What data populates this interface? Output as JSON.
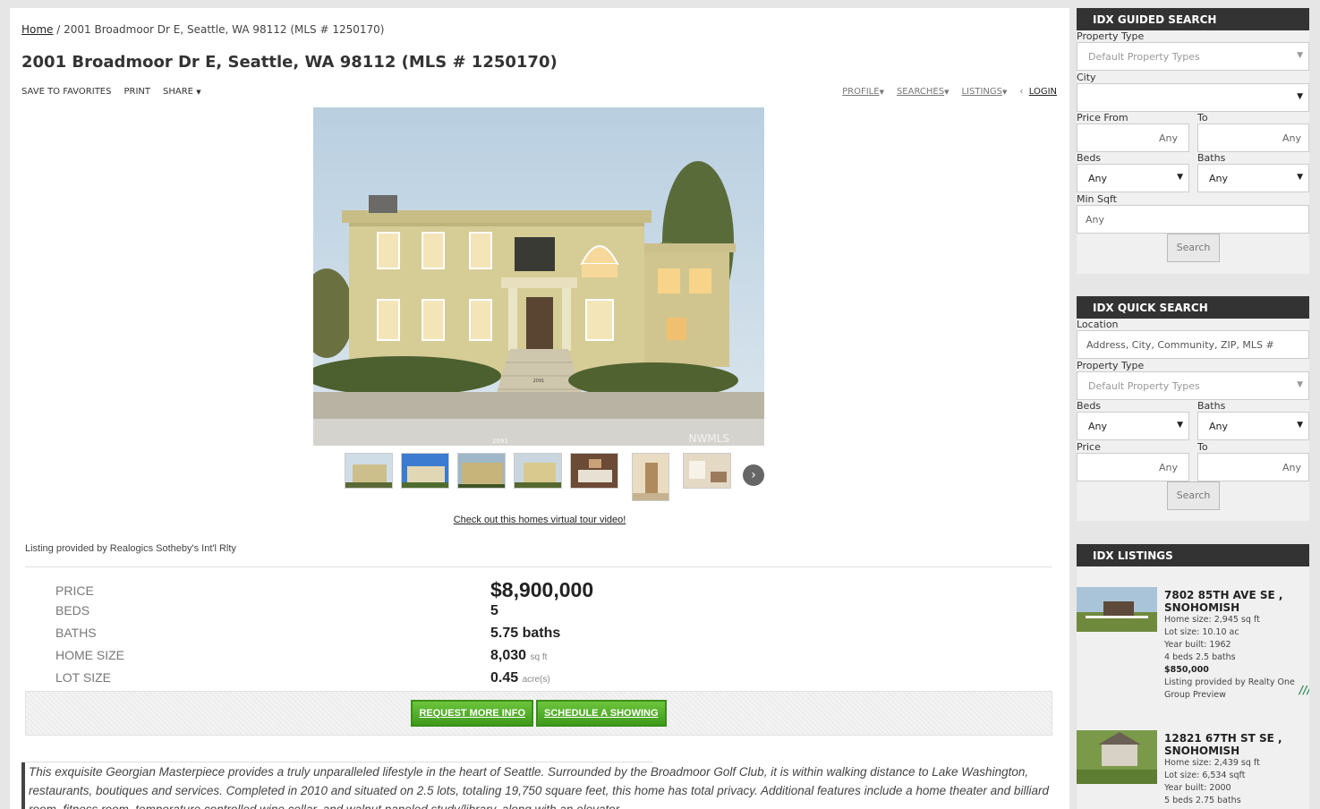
{
  "breadcrumb": {
    "home": "Home",
    "separator": " / ",
    "current": "2001 Broadmoor Dr E, Seattle, WA 98112 (MLS # 1250170)"
  },
  "page_title": "2001 Broadmoor Dr E, Seattle, WA 98112 (MLS # 1250170)",
  "actions": {
    "save": "SAVE TO FAVORITES",
    "print": "PRINT",
    "share": "SHARE"
  },
  "nav": {
    "profile": "PROFILE",
    "searches": "SEARCHES",
    "listings": "LISTINGS",
    "login": "LOGIN"
  },
  "hero": {
    "house_number": "2091",
    "street_number": "2091",
    "watermark": "NWMLS"
  },
  "virtual_tour": "Check out this homes virtual tour video!",
  "listing_provided": "Listing provided by Realogics Sotheby's Int'l Rlty",
  "facts": [
    {
      "label": "PRICE",
      "value": "$8,900,000",
      "unit": ""
    },
    {
      "label": "BEDS",
      "value": "5",
      "unit": ""
    },
    {
      "label": "BATHS",
      "value": "5.75 baths",
      "unit": ""
    },
    {
      "label": "HOME SIZE",
      "value": "8,030",
      "unit": "sq ft"
    },
    {
      "label": "LOT SIZE",
      "value": "0.45",
      "unit": "acre(s)"
    }
  ],
  "cta": {
    "request": "REQUEST MORE INFO",
    "schedule": "SCHEDULE A SHOWING"
  },
  "description": "This exquisite Georgian Masterpiece provides a truly unparalleled lifestyle in the heart of Seattle. Surrounded by the Broadmoor Golf Club, it is within walking distance to Lake Washington, restaurants, boutiques and services. Completed in 2010 and situated on 2.5 lots, totaling 19,750 square feet, this home has total privacy. Additional features include a home theater and billiard room, fitness room, temperature controlled wine cellar, and walnut paneled study/library, along with an elevator.",
  "guided_search": {
    "title": "IDX GUIDED SEARCH",
    "property_type_label": "Property Type",
    "property_type_value": "Default Property Types",
    "city_label": "City",
    "city_value": "",
    "price_from_label": "Price From",
    "price_from_value": "Any",
    "to_label": "To",
    "to_value": "Any",
    "beds_label": "Beds",
    "beds_value": "Any",
    "baths_label": "Baths",
    "baths_value": "Any",
    "min_sqft_label": "Min Sqft",
    "min_sqft_value": "Any",
    "search": "Search"
  },
  "quick_search": {
    "title": "IDX QUICK SEARCH",
    "location_label": "Location",
    "location_placeholder": "Address, City, Community, ZIP, MLS #",
    "property_type_label": "Property Type",
    "property_type_value": "Default Property Types",
    "beds_label": "Beds",
    "beds_value": "Any",
    "baths_label": "Baths",
    "baths_value": "Any",
    "price_label": "Price",
    "price_value": "Any",
    "to_label": "To",
    "to_value": "Any",
    "search": "Search"
  },
  "idx_listings": {
    "title": "IDX LISTINGS",
    "items": [
      {
        "address": "7802 85TH AVE SE , SNOHOMISH",
        "home_size": "Home size: 2,945 sq ft",
        "lot_size": "Lot size: 10.10 ac",
        "year": "Year built: 1962",
        "beds_baths": "4 beds 2.5 baths",
        "price": "$850,000",
        "provided": "Listing provided by Realty One Group Preview"
      },
      {
        "address": "12821 67TH ST SE , SNOHOMISH",
        "home_size": "Home size: 2,439 sq ft",
        "lot_size": "Lot size: 6,534 sqft",
        "year": "Year built: 2000",
        "beds_baths": "5 beds 2.75 baths"
      }
    ]
  },
  "icons": {
    "caret": "caret-down-icon",
    "chevron": "chevron-right-icon",
    "back": "chevron-left-icon"
  }
}
